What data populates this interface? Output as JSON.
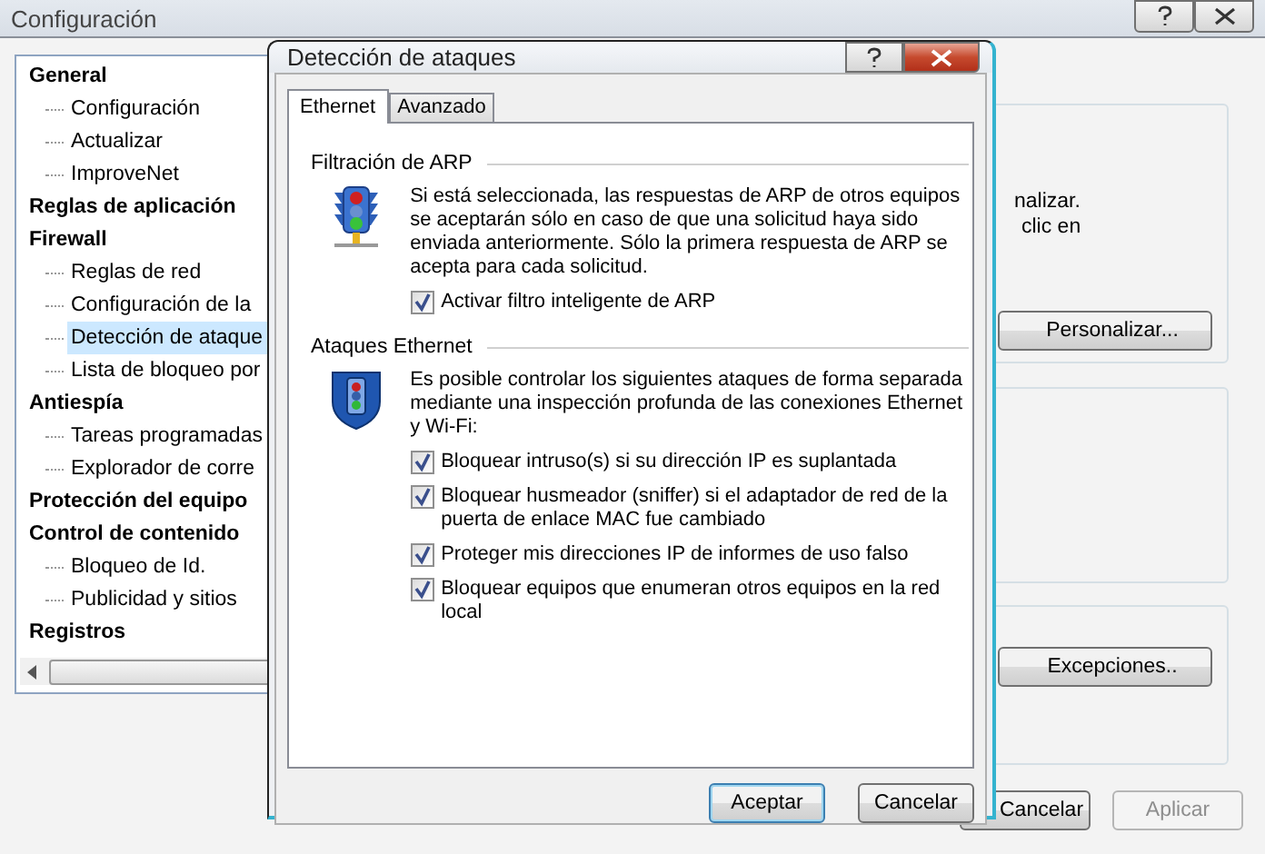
{
  "window": {
    "title": "Configuración"
  },
  "tree": [
    {
      "label": "General",
      "selected": false,
      "children": [
        {
          "label": "Configuración",
          "selected": false
        },
        {
          "label": "Actualizar",
          "selected": false
        },
        {
          "label": "ImproveNet",
          "selected": false
        }
      ]
    },
    {
      "label": "Reglas de aplicación",
      "selected": false
    },
    {
      "label": "Firewall",
      "selected": false,
      "children": [
        {
          "label": "Reglas de red",
          "selected": false
        },
        {
          "label": "Configuración de la",
          "selected": false
        },
        {
          "label": "Detección de ataque",
          "selected": true
        },
        {
          "label": "Lista de bloqueo por",
          "selected": false
        }
      ]
    },
    {
      "label": "Antiespía",
      "selected": false,
      "children": [
        {
          "label": "Tareas programadas",
          "selected": false
        },
        {
          "label": "Explorador de corre",
          "selected": false
        }
      ]
    },
    {
      "label": "Protección del equipo",
      "selected": false
    },
    {
      "label": "Control de contenido",
      "selected": false,
      "children": [
        {
          "label": "Bloqueo de Id.",
          "selected": false
        },
        {
          "label": "Publicidad y sitios",
          "selected": false
        }
      ]
    },
    {
      "label": "Registros",
      "selected": false
    }
  ],
  "background_panel": {
    "text_lines": [
      "nalizar.",
      "clic en"
    ],
    "buttons": [
      "Personalizar...",
      "Excepciones.."
    ]
  },
  "footer_buttons": [
    {
      "label": "Cancelar",
      "disabled": false
    },
    {
      "label": "Aplicar",
      "disabled": true
    }
  ],
  "dialog": {
    "title": "Detección de ataques",
    "tabs": [
      {
        "label": "Ethernet",
        "selected": true
      },
      {
        "label": "Avanzado",
        "selected": false
      }
    ],
    "sections": [
      {
        "kind": "arp",
        "title": "Filtración de ARP",
        "description": "Si está seleccionada, las respuestas de ARP de otros equipos se aceptarán sólo en caso de que una solicitud haya sido enviada anteriormente. Sólo la primera respuesta de ARP se acepta para cada solicitud.",
        "options": [
          {
            "label": "Activar filtro inteligente de ARP",
            "checked": true
          }
        ]
      },
      {
        "kind": "ethernet",
        "title": "Ataques Ethernet",
        "description": "Es posible controlar los siguientes ataques de forma separada mediante una inspección profunda de las conexiones Ethernet y Wi-Fi:",
        "options": [
          {
            "label": "Bloquear intruso(s) si su dirección IP es suplantada",
            "checked": true
          },
          {
            "label": "Bloquear husmeador (sniffer) si el adaptador de red de la puerta de enlace MAC fue cambiado",
            "checked": true
          },
          {
            "label": "Proteger mis direcciones IP de informes de uso falso",
            "checked": true
          },
          {
            "label": "Bloquear equipos que enumeran otros equipos en la red local",
            "checked": true
          }
        ]
      }
    ],
    "buttons": [
      "Aceptar",
      "Cancelar"
    ]
  }
}
